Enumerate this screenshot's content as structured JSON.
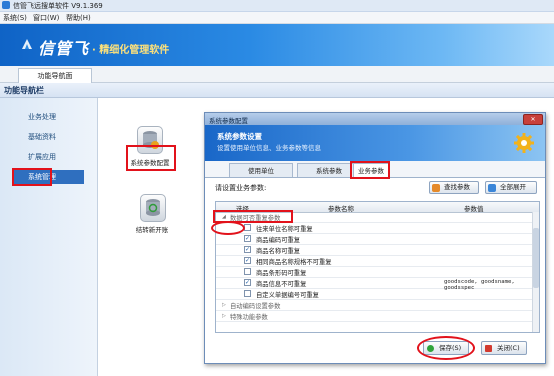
{
  "app": {
    "title": "信管飞远搜单软件 V9.1.369"
  },
  "menu": {
    "items": [
      "系统(S)",
      "窗口(W)",
      "帮助(H)"
    ]
  },
  "banner": {
    "brand": "信管飞",
    "slogan": "· 精细化管理软件"
  },
  "tab_strip": {
    "label": "功能导航面"
  },
  "nav_header": {
    "title": "功能导航栏"
  },
  "sidebar": {
    "items": [
      {
        "label": "业务处理",
        "active": false
      },
      {
        "label": "基础资料",
        "active": false
      },
      {
        "label": "扩展应用",
        "active": false
      },
      {
        "label": "系统管理",
        "active": true
      }
    ]
  },
  "tiles": [
    {
      "label": "系统参数配置",
      "icon": "database-gear-icon"
    },
    {
      "label": "结转新开账",
      "icon": "database-refresh-icon"
    }
  ],
  "dialog": {
    "title": "系统参数配置",
    "close_label": "✕",
    "header_title": "系统参数设置",
    "header_sub": "设置使用单位信息、业务参数等信息",
    "tabs": [
      {
        "label": "使用单位",
        "selected": false
      },
      {
        "label": "系统参数",
        "selected": false
      },
      {
        "label": "业务参数",
        "selected": true
      }
    ],
    "prompt": "请设置业务参数:",
    "find_label": "查找参数",
    "expand_label": "全部展开",
    "grid": {
      "headers": [
        "选择",
        "参数名称",
        "参数值"
      ],
      "rows": [
        {
          "type": "group",
          "expanded": true,
          "name": "数据可否重复参数",
          "value": ""
        },
        {
          "type": "item",
          "checked": false,
          "name": "往来单位名称可重复",
          "value": ""
        },
        {
          "type": "item",
          "checked": true,
          "name": "商品编码可重复",
          "value": ""
        },
        {
          "type": "item",
          "checked": true,
          "name": "商品名称可重复",
          "value": ""
        },
        {
          "type": "item",
          "checked": true,
          "name": "相同商品名称规格不可重复",
          "value": ""
        },
        {
          "type": "item",
          "checked": false,
          "name": "商品条形码可重复",
          "value": ""
        },
        {
          "type": "item",
          "checked": true,
          "name": "商品信息不可重复",
          "value": "goodscode, goodsname, goodsspec"
        },
        {
          "type": "item",
          "checked": false,
          "name": "自定义单据编号可重复",
          "value": ""
        },
        {
          "type": "group",
          "expanded": false,
          "name": "自动编码设置参数",
          "value": ""
        },
        {
          "type": "group",
          "expanded": false,
          "name": "特殊功能参数",
          "value": ""
        }
      ]
    },
    "save_label": "保存(S)",
    "close_btn_label": "关闭(C)"
  },
  "colors": {
    "accent": "#2f6fbf",
    "highlight": "#e2121b"
  }
}
